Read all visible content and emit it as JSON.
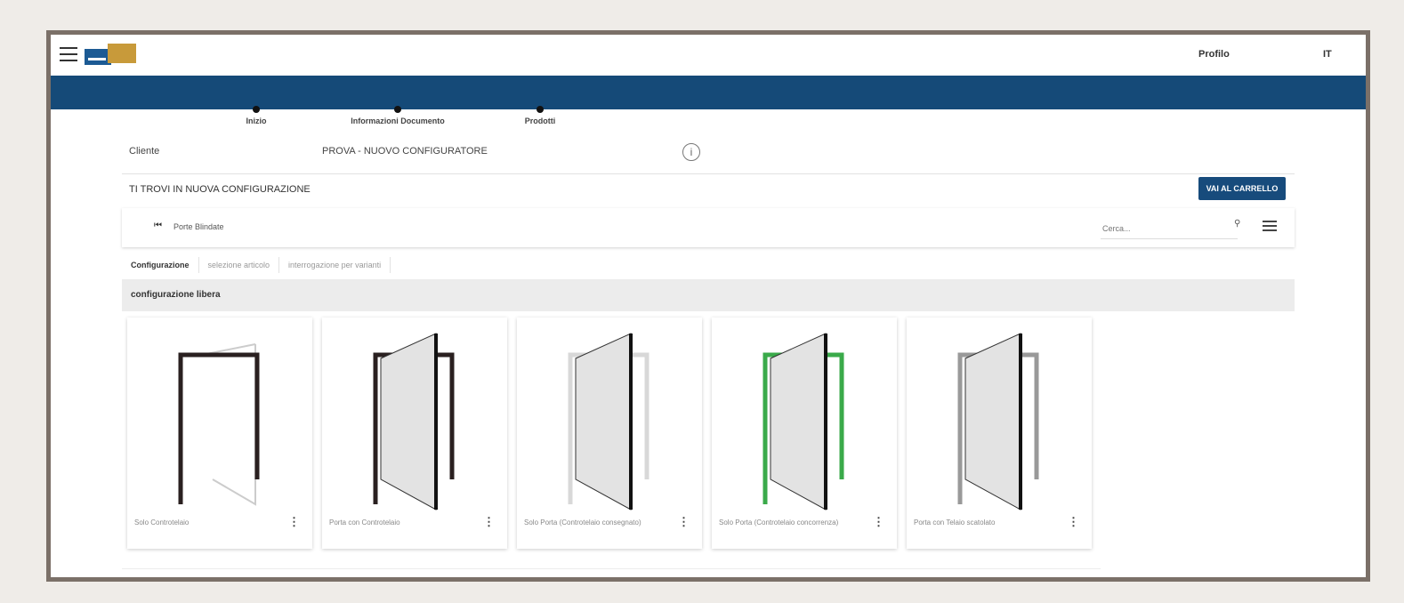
{
  "header": {
    "profile_label": "Profilo",
    "lang_label": "IT",
    "menu_icon": "hamburger-icon",
    "logo_icon": "brand-logo"
  },
  "steps": [
    {
      "label": "Inizio"
    },
    {
      "label": "Informazioni Documento"
    },
    {
      "label": "Prodotti"
    }
  ],
  "customer": {
    "label": "Cliente",
    "value": "PROVA - NUOVO CONFIGURATORE",
    "info_icon": "info-icon"
  },
  "status": {
    "text": "TI TROVI IN NUOVA CONFIGURAZIONE",
    "cart_button": "VAI AL CARRELLO"
  },
  "breadcrumb": {
    "first_icon": "first-page-icon",
    "item": "Porte Blindate"
  },
  "search": {
    "placeholder": "Cerca...",
    "icon": "search-icon",
    "list_icon": "list-view-icon"
  },
  "tabs": [
    {
      "label": "Configurazione",
      "active": true
    },
    {
      "label": "selezione articolo",
      "active": false
    },
    {
      "label": "interrogazione per varianti",
      "active": false
    }
  ],
  "section_title": "configurazione libera",
  "cards": [
    {
      "label": "Solo Controtelaio",
      "frame_color": "#2a2020"
    },
    {
      "label": "Porta con Controtelaio",
      "frame_color": "#2a2020"
    },
    {
      "label": "Solo Porta (Controtelaio consegnato)",
      "frame_color": "#d8d8d8"
    },
    {
      "label": "Solo Porta (Controtelaio concorrenza)",
      "frame_color": "#3aaa4a"
    },
    {
      "label": "Porta con Telaio scatolato",
      "frame_color": "#999999"
    }
  ],
  "colors": {
    "blue_bar": "#154a78",
    "button": "#174b7c",
    "border": "#7b7068"
  }
}
